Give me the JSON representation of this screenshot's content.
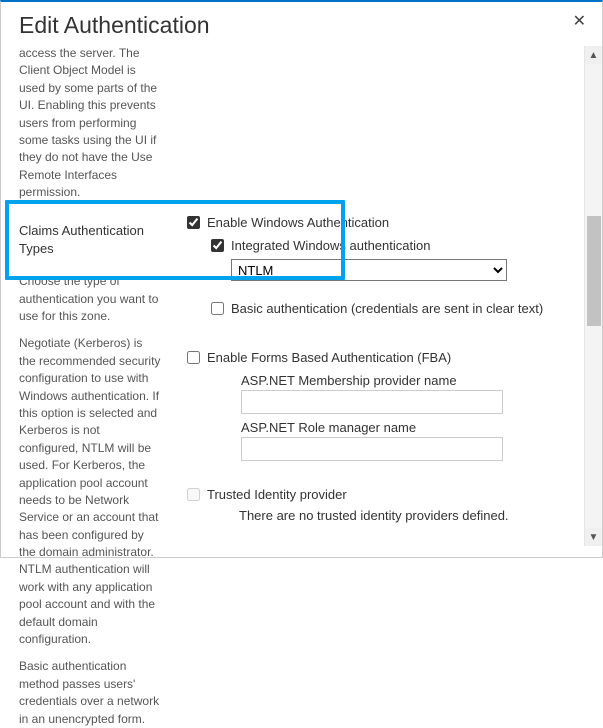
{
  "dialog": {
    "title": "Edit Authentication",
    "close_label": "✕"
  },
  "left": {
    "remote_desc": "access the server. The Client Object Model is used by some parts of the UI. Enabling this prevents users from performing some tasks using the UI if they do not have the Use Remote Interfaces permission.",
    "section_title": "Claims Authentication Types",
    "choose_desc": "Choose the type of authentication you want to use for this zone.",
    "negotiate_desc": "Negotiate (Kerberos) is the recommended security configuration to use with Windows authentication. If this option is selected and Kerberos is not configured, NTLM will be used. For Kerberos, the application pool account needs to be Network Service or an account that has been configured by the domain administrator. NTLM authentication will work with any application pool account and with the default domain configuration.",
    "basic_desc": "Basic authentication method passes users' credentials over a network in an unencrypted form."
  },
  "form": {
    "enable_windows": "Enable Windows Authentication",
    "integrated": "Integrated Windows authentication",
    "auth_mode": "NTLM",
    "basic_auth": "Basic authentication (credentials are sent in clear text)",
    "enable_fba": "Enable Forms Based Authentication (FBA)",
    "membership_label": "ASP.NET Membership provider name",
    "role_label": "ASP.NET Role manager name",
    "trusted": "Trusted Identity provider",
    "no_trusted": "There are no trusted identity providers defined."
  },
  "scrollbar": {
    "up": "▲",
    "down": "▼"
  }
}
